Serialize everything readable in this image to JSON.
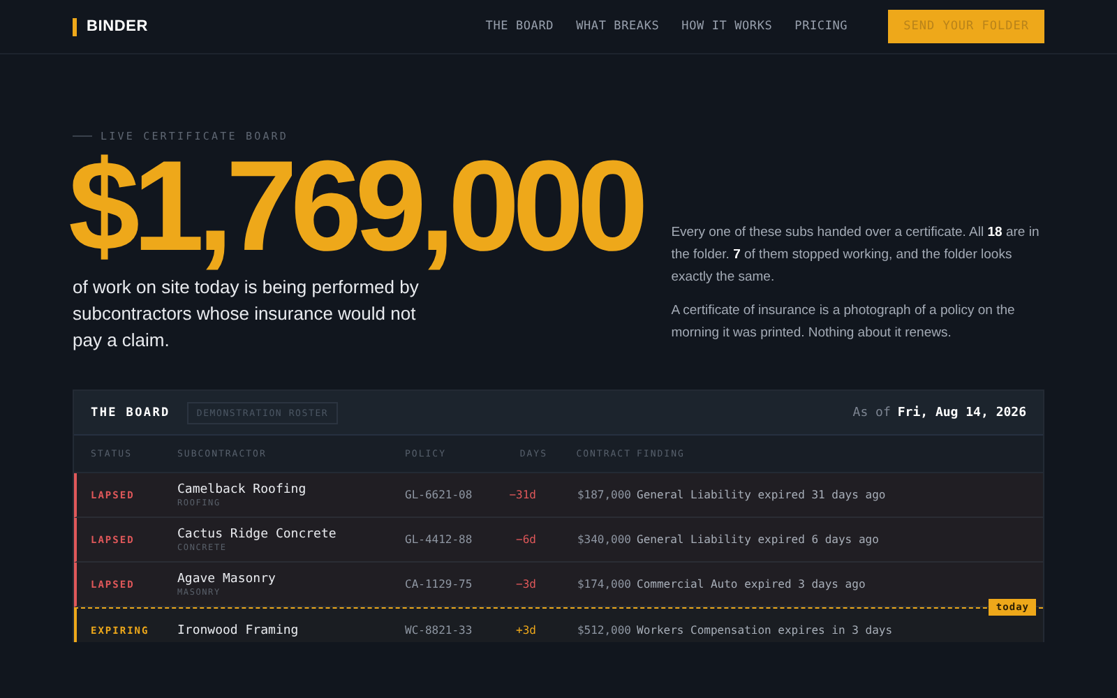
{
  "nav": {
    "brand": "BINDER",
    "links": [
      "THE BOARD",
      "WHAT BREAKS",
      "HOW IT WORKS",
      "PRICING"
    ],
    "cta": "SEND YOUR FOLDER"
  },
  "hero": {
    "eyebrow": "LIVE CERTIFICATE BOARD",
    "amount": "$1,769,000",
    "subline": "of work on site today is being performed by subcontractors whose insurance would not pay a claim.",
    "paragraphs": [
      "Every one of these subs handed over a certificate. All **18** are in the folder. **7** of them stopped working, and the folder looks exactly the same.",
      "A certificate of insurance is a photograph of a policy on the morning it was printed. Nothing about it renews."
    ]
  },
  "board": {
    "title": "THE BOARD",
    "tag": "DEMONSTRATION ROSTER",
    "as_of_label": "As of",
    "as_of_date": "Fri, Aug 14, 2026",
    "today_label": "today",
    "columns": [
      "STATUS",
      "SUBCONTRACTOR",
      "POLICY",
      "DAYS",
      "CONTRACT",
      "FINDING"
    ],
    "rows": [
      {
        "kind": "lapsed",
        "status": "LAPSED",
        "name": "Camelback Roofing",
        "trade": "ROOFING",
        "policy": "GL-6621-08",
        "days": "−31d",
        "contract": "$187,000",
        "finding": "General Liability expired 31 days ago"
      },
      {
        "kind": "lapsed",
        "status": "LAPSED",
        "name": "Cactus Ridge Concrete",
        "trade": "CONCRETE",
        "policy": "GL-4412-88",
        "days": "−6d",
        "contract": "$340,000",
        "finding": "General Liability expired 6 days ago"
      },
      {
        "kind": "lapsed",
        "status": "LAPSED",
        "name": "Agave Masonry",
        "trade": "MASONRY",
        "policy": "CA-1129-75",
        "days": "−3d",
        "contract": "$174,000",
        "finding": "Commercial Auto expired 3 days ago"
      },
      {
        "kind": "expiring",
        "status": "EXPIRING",
        "name": "Ironwood Framing",
        "policy": "WC-8821-33",
        "days": "+3d",
        "contract": "$512,000",
        "finding": "Workers Compensation expires in 3 days"
      }
    ]
  }
}
